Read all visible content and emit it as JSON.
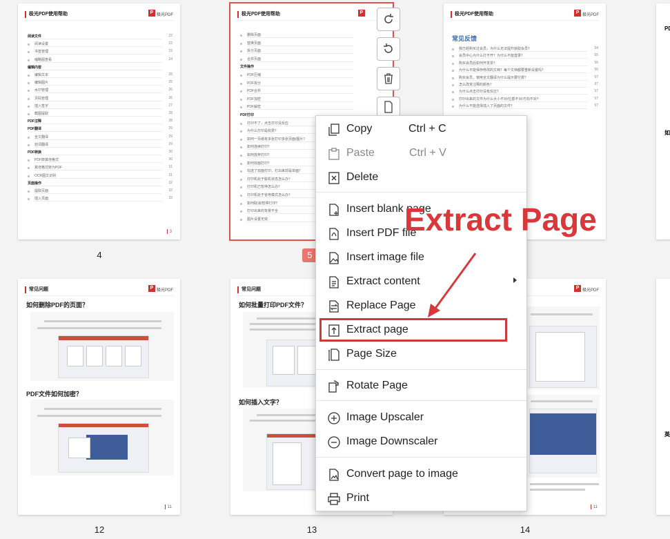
{
  "page_header": {
    "title": "极光PDF使用帮助",
    "logo_text": "极光PDF"
  },
  "faq_header": {
    "title": "常见问题"
  },
  "thumbnails": [
    {
      "number": "4",
      "footer": "3"
    },
    {
      "number": "5",
      "selected": true
    },
    {
      "number": "",
      "heading": "常见反馈"
    },
    {
      "number": "12",
      "heading_1": "如何删除PDF的页面？",
      "heading_2": "PDF文件如何加密？",
      "footer": "11"
    },
    {
      "number": "13",
      "heading_1": "如何批量打印PDF文件？",
      "heading_2": "如何插入文字？"
    },
    {
      "number": "14",
      "footer": "11"
    }
  ],
  "page4_toc": {
    "items": [
      {
        "text": "阅读文件",
        "page": "22",
        "bold": true
      },
      {
        "text": "阅读设置",
        "page": "22"
      },
      {
        "text": "书签管理",
        "page": "23"
      },
      {
        "text": "缩略图查看",
        "page": "24"
      },
      {
        "text": "编辑内容",
        "page": "",
        "bold": true
      },
      {
        "text": "编辑文本",
        "page": "25"
      },
      {
        "text": "编辑图片",
        "page": "25"
      },
      {
        "text": "水印管理",
        "page": "26"
      },
      {
        "text": "页码管理",
        "page": "26"
      },
      {
        "text": "插入签字",
        "page": "27"
      },
      {
        "text": "截图提取",
        "page": "28"
      },
      {
        "text": "PDF注释",
        "page": "28",
        "bold": true
      },
      {
        "text": "PDF翻译",
        "page": "29",
        "bold": true
      },
      {
        "text": "全文翻译",
        "page": "29"
      },
      {
        "text": "划词翻译",
        "page": "29"
      },
      {
        "text": "PDF转换",
        "page": "30",
        "bold": true
      },
      {
        "text": "PDF转其他格式",
        "page": "30"
      },
      {
        "text": "其他格式转为PDF",
        "page": "31"
      },
      {
        "text": "OCR图文识别",
        "page": "31"
      },
      {
        "text": "页面操作",
        "page": "32",
        "bold": true
      },
      {
        "text": "提取页面",
        "page": "32"
      },
      {
        "text": "插入页面",
        "page": "33"
      }
    ]
  },
  "page5_toc": {
    "items": [
      {
        "text": "删除页面"
      },
      {
        "text": "替换页面"
      },
      {
        "text": "拆分页面"
      },
      {
        "text": "合并页面"
      },
      {
        "text": "文件操作",
        "bold": true
      },
      {
        "text": "PDF压缩"
      },
      {
        "text": "PDF拆分"
      },
      {
        "text": "PDF合并"
      },
      {
        "text": "PDF加密"
      },
      {
        "text": "PDF解密"
      },
      {
        "text": "PDF打印",
        "bold": true
      },
      {
        "text": "打印不了，点击打印没反应"
      },
      {
        "text": "为什么打印是收费？"
      },
      {
        "text": "如何一页纸有多张打印多张页面/图片？"
      },
      {
        "text": "如何连续打印？"
      },
      {
        "text": "如何放弃打印？"
      },
      {
        "text": "如何双面打印？"
      },
      {
        "text": "勾选了双面打印，打出来却是单面？"
      },
      {
        "text": "打印机处于脱机状态怎么办？"
      },
      {
        "text": "打印机已暂停怎么办？"
      },
      {
        "text": "打印机处于省电模式怎么办？"
      },
      {
        "text": "如何取消/暂停打印？"
      },
      {
        "text": "打印出来的背景不全"
      },
      {
        "text": "图片设置无效"
      }
    ]
  },
  "page6_toc": {
    "items": [
      {
        "text": "我已经购买过会员，为什么无法提升获取会员？",
        "page": "54"
      },
      {
        "text": "会员中心为什么打不开？为什么不能登录？",
        "page": "55"
      },
      {
        "text": "购买会员后如何开发票？",
        "page": "56"
      },
      {
        "text": "为什么不能保存修改的文档？每个文档都要重新设置吗？",
        "page": "56"
      },
      {
        "text": "购买会员，使用全文翻译为什么提示要付费？",
        "page": "57"
      },
      {
        "text": "怎么改变注释的颜色？",
        "page": "57"
      },
      {
        "text": "为什么点击打印没有反应？",
        "page": "57"
      },
      {
        "text": "打印出来的文件为什么大小不对/位置不对/方向不对？",
        "page": "57"
      },
      {
        "text": "为什么不能选择插入了页面的文件？",
        "page": "57"
      }
    ]
  },
  "toolbar": [
    {
      "name": "rotate-right-button",
      "icon": "rotate-clockwise-icon"
    },
    {
      "name": "rotate-left-button",
      "icon": "rotate-counterclockwise-icon"
    },
    {
      "name": "delete-page-button",
      "icon": "trash-icon"
    },
    {
      "name": "insert-page-button",
      "icon": "insert-page-icon"
    }
  ],
  "context_menu": {
    "copy": {
      "label": "Copy",
      "shortcut": "Ctrl + C"
    },
    "paste": {
      "label": "Paste",
      "shortcut": "Ctrl + V"
    },
    "delete": {
      "label": "Delete"
    },
    "insert_blank": {
      "label": "Insert blank page"
    },
    "insert_pdf": {
      "label": "Insert PDF file"
    },
    "insert_image": {
      "label": "Insert image file"
    },
    "extract_content": {
      "label": "Extract content"
    },
    "replace_page": {
      "label": "Replace Page"
    },
    "extract_page": {
      "label": "Extract page"
    },
    "page_size": {
      "label": "Page Size"
    },
    "rotate_page": {
      "label": "Rotate Page"
    },
    "image_upscaler": {
      "label": "Image Upscaler"
    },
    "image_downscaler": {
      "label": "Image Downscaler"
    },
    "convert_to_image": {
      "label": "Convert page to image"
    },
    "print": {
      "label": "Print"
    }
  },
  "annotation": {
    "callout_text": "Extract Page",
    "highlight_color": "#d0393a"
  },
  "colors": {
    "accent_red": "#d32f2f",
    "blue_heading": "#3b6cb5",
    "annotation_red": "#d9383a"
  }
}
